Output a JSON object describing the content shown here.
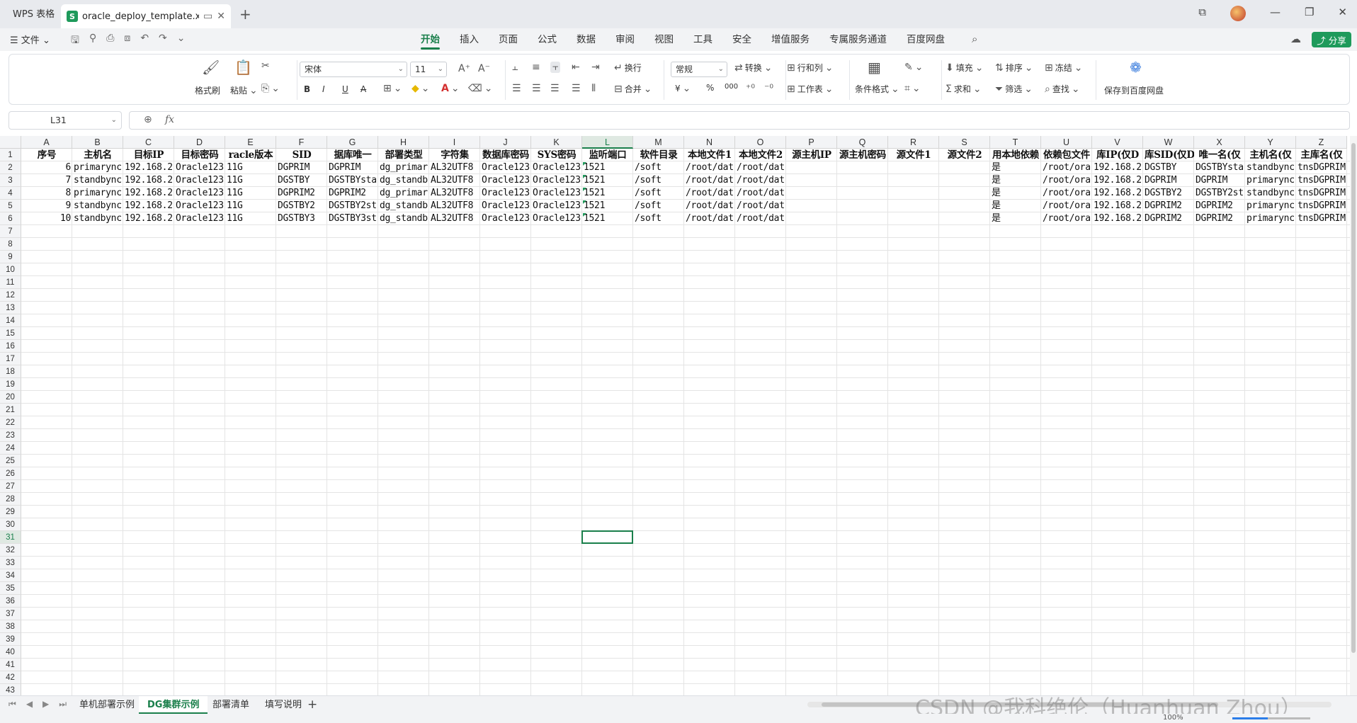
{
  "titlebar": {
    "app_name": "WPS 表格",
    "doc_name": "oracle_deploy_template.xlsx",
    "sheet_logo": "S",
    "new_tab": "+"
  },
  "menubar": {
    "file_label": "文件",
    "tabs": [
      "开始",
      "插入",
      "页面",
      "公式",
      "数据",
      "审阅",
      "视图",
      "工具",
      "安全",
      "增值服务",
      "专属服务通道",
      "百度网盘"
    ],
    "active_tab": "开始",
    "share_label": "分享"
  },
  "ribbon": {
    "format_painter": "格式刷",
    "paste": "粘贴",
    "font_name": "宋体",
    "font_size": "11",
    "wrap": "换行",
    "merge": "合并",
    "number_format": "常规",
    "convert": "转换",
    "row_col": "行和列",
    "worksheet": "工作表",
    "cond_format": "条件格式",
    "fill": "填充",
    "sort": "排序",
    "freeze": "冻结",
    "sum": "求和",
    "filter": "筛选",
    "find": "查找",
    "save_baidu": "保存到百度网盘",
    "bold": "B",
    "italic": "I",
    "underline": "U",
    "strike": "A",
    "yen": "¥",
    "percent": "%",
    "thousands": "000"
  },
  "formula_bar": {
    "cell_ref": "L31",
    "fx": "fx",
    "content": ""
  },
  "columns": [
    "A",
    "B",
    "C",
    "D",
    "E",
    "F",
    "G",
    "H",
    "I",
    "J",
    "K",
    "L",
    "M",
    "N",
    "O",
    "P",
    "Q",
    "R",
    "S",
    "T",
    "U",
    "V",
    "W",
    "X",
    "Y",
    "Z"
  ],
  "selected_col": "L",
  "rows": {
    "visible_count": 43,
    "selected_row": 31
  },
  "table": {
    "headers": [
      "序号",
      "主机名",
      "目标IP",
      "目标密码",
      "racle版本",
      "SID",
      "据库唯一",
      "部署类型",
      "字符集",
      "数据库密码",
      "SYS密码",
      "监听端口",
      "软件目录",
      "本地文件1",
      "本地文件2",
      "源主机IP",
      "源主机密码",
      "源文件1",
      "源文件2",
      "用本地依赖",
      "依赖包文件",
      "库IP(仅D",
      "库SID(仅D",
      "唯一名(仅",
      "主机名(仅",
      "主库名(仅"
    ],
    "rows": [
      [
        "6",
        "primarync",
        "192.168.2",
        "Oracle123",
        "11G",
        "DGPRIM",
        "DGPRIM",
        "dg_primar",
        "AL32UTF8",
        "Oracle123",
        "Oracle123",
        "1521",
        "/soft",
        "/root/dat",
        "/root/dat",
        "",
        "",
        "",
        "",
        "是",
        "/root/ora",
        "192.168.2",
        "DGSTBY",
        "DGSTBYsta",
        "standbync",
        "tnsDGPRIM"
      ],
      [
        "7",
        "standbync",
        "192.168.2",
        "Oracle123",
        "11G",
        "DGSTBY",
        "DGSTBYsta",
        "dg_standb",
        "AL32UTF8",
        "Oracle123",
        "Oracle123",
        "1521",
        "/soft",
        "/root/dat",
        "/root/dat",
        "",
        "",
        "",
        "",
        "是",
        "/root/ora",
        "192.168.2",
        "DGPRIM",
        "DGPRIM",
        "primarync",
        "tnsDGPRIM"
      ],
      [
        "8",
        "primarync",
        "192.168.2",
        "Oracle123",
        "11G",
        "DGPRIM2",
        "DGPRIM2",
        "dg_primar",
        "AL32UTF8",
        "Oracle123",
        "Oracle123",
        "1521",
        "/soft",
        "/root/dat",
        "/root/dat",
        "",
        "",
        "",
        "",
        "是",
        "/root/ora",
        "192.168.2",
        "DGSTBY2",
        "DGSTBY2st",
        "standbync",
        "tnsDGPRIM"
      ],
      [
        "9",
        "standbync",
        "192.168.2",
        "Oracle123",
        "11G",
        "DGSTBY2",
        "DGSTBY2st",
        "dg_standb",
        "AL32UTF8",
        "Oracle123",
        "Oracle123",
        "1521",
        "/soft",
        "/root/dat",
        "/root/dat",
        "",
        "",
        "",
        "",
        "是",
        "/root/ora",
        "192.168.2",
        "DGPRIM2",
        "DGPRIM2",
        "primarync",
        "tnsDGPRIM"
      ],
      [
        "10",
        "standbync",
        "192.168.2",
        "Oracle123",
        "11G",
        "DGSTBY3",
        "DGSTBY3st",
        "dg_standb",
        "AL32UTF8",
        "Oracle123",
        "Oracle123",
        "1521",
        "/soft",
        "/root/dat",
        "/root/dat",
        "",
        "",
        "",
        "",
        "是",
        "/root/ora",
        "192.168.2",
        "DGPRIM2",
        "DGPRIM2",
        "primarync",
        "tnsDGPRIM"
      ]
    ]
  },
  "sheets": [
    "单机部署示例",
    "DG集群示例",
    "部署清单",
    "填写说明"
  ],
  "active_sheet": "DG集群示例",
  "watermark": "CSDN @我科绝伦（Huanhuan Zhou）",
  "status": {
    "zoom": "100%",
    "zoom_level": 0.45
  },
  "colors": {
    "accent": "#1a7f4b",
    "share": "#1e9a5b"
  }
}
